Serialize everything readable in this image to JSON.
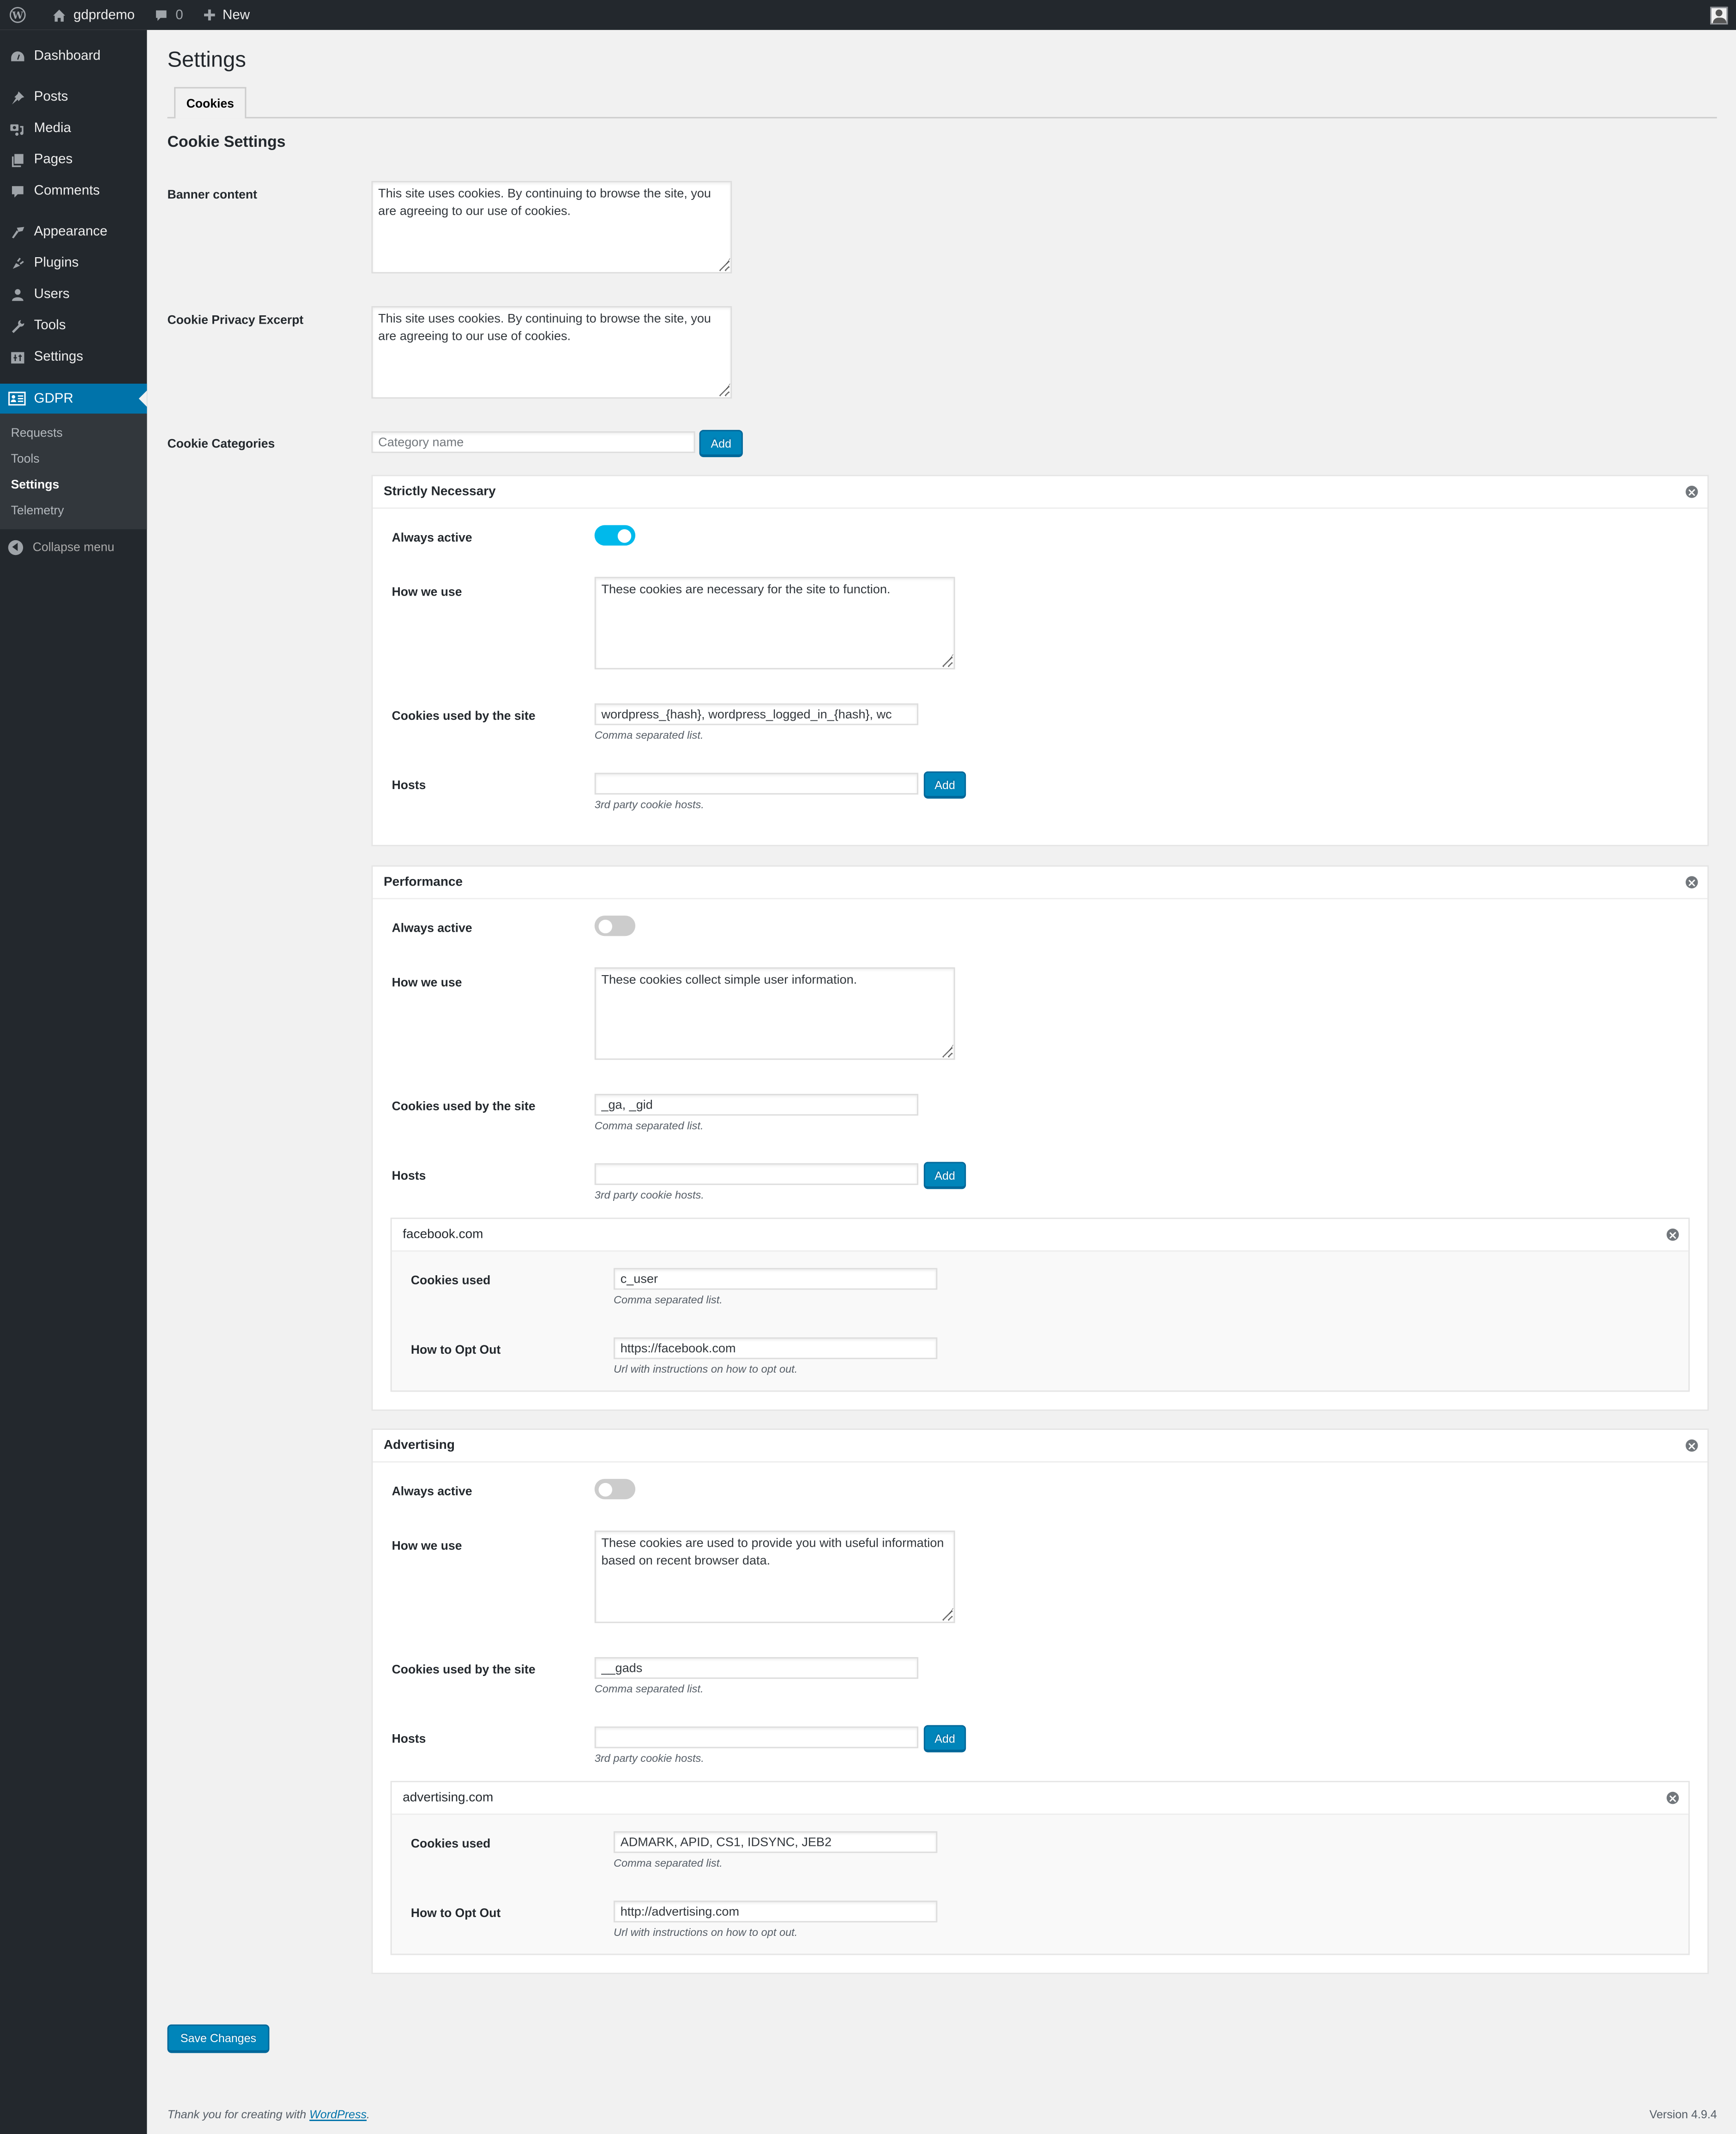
{
  "adminbar": {
    "site_name": "gdprdemo",
    "comments_count": "0",
    "new_label": "New"
  },
  "sidebar": {
    "items": [
      {
        "label": "Dashboard",
        "icon": "dashboard-icon"
      },
      {
        "label": "Posts",
        "icon": "pushpin-icon"
      },
      {
        "label": "Media",
        "icon": "media-icon"
      },
      {
        "label": "Pages",
        "icon": "pages-icon"
      },
      {
        "label": "Comments",
        "icon": "comment-icon"
      },
      {
        "label": "Appearance",
        "icon": "paintbrush-icon"
      },
      {
        "label": "Plugins",
        "icon": "plugin-icon"
      },
      {
        "label": "Users",
        "icon": "user-icon"
      },
      {
        "label": "Tools",
        "icon": "wrench-icon"
      },
      {
        "label": "Settings",
        "icon": "settings-icon"
      }
    ],
    "current": {
      "label": "GDPR",
      "icon": "id-card-icon"
    },
    "submenu": [
      "Requests",
      "Tools",
      "Settings",
      "Telemetry"
    ],
    "submenu_active": "Settings",
    "collapse_label": "Collapse menu"
  },
  "page": {
    "title": "Settings",
    "tabs": [
      {
        "label": "Cookies",
        "active": true
      }
    ],
    "section_title": "Cookie Settings",
    "banner_label": "Banner content",
    "banner_value": "This site uses cookies. By continuing to browse the site, you are agreeing to our use of cookies.",
    "excerpt_label": "Cookie Privacy Excerpt",
    "excerpt_value": "This site uses cookies. By continuing to browse the site, you are agreeing to our use of cookies.",
    "categories_label": "Cookie Categories",
    "category_placeholder": "Category name",
    "add_label": "Add"
  },
  "labels": {
    "always_active": "Always active",
    "how_we_use": "How we use",
    "cookies_used_site": "Cookies used by the site",
    "comma_desc": "Comma separated list.",
    "hosts": "Hosts",
    "hosts_desc": "3rd party cookie hosts.",
    "add": "Add",
    "cookies_used": "Cookies used",
    "opt_out": "How to Opt Out",
    "opt_out_desc": "Url with instructions on how to opt out."
  },
  "categories": [
    {
      "name": "Strictly Necessary",
      "always_active": true,
      "how_we_use": "These cookies are necessary for the site to function.",
      "cookies": "wordpress_{hash}, wordpress_logged_in_{hash}, wc",
      "hosts_input": "",
      "hosts": []
    },
    {
      "name": "Performance",
      "always_active": false,
      "how_we_use": "These cookies collect simple user information.",
      "cookies": "_ga, _gid",
      "hosts_input": "",
      "hosts": [
        {
          "name": "facebook.com",
          "cookies_used": "c_user",
          "opt_out": "https://facebook.com"
        }
      ]
    },
    {
      "name": "Advertising",
      "always_active": false,
      "how_we_use": "These cookies are used to provide you with useful information based on recent browser data.",
      "cookies": "__gads",
      "hosts_input": "",
      "hosts": [
        {
          "name": "advertising.com",
          "cookies_used": "ADMARK, APID, CS1, IDSYNC, JEB2",
          "opt_out": "http://advertising.com"
        }
      ]
    }
  ],
  "save_label": "Save Changes",
  "footer": {
    "thanks_prefix": "Thank you for creating with ",
    "thanks_link": "WordPress",
    "thanks_suffix": ".",
    "version": "Version 4.9.4"
  },
  "colors": {
    "accent": "#0073aa",
    "button": "#0085ba",
    "toggle_on": "#00b9eb",
    "toggle_off": "#cccccc",
    "adminbar": "#23282d"
  }
}
